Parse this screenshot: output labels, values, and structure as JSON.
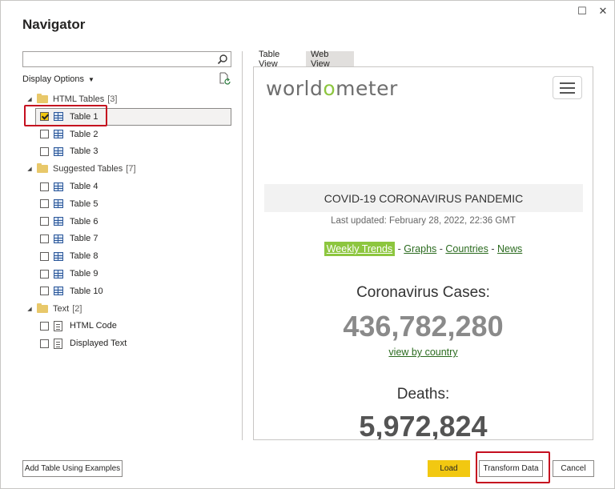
{
  "dialog": {
    "title": "Navigator",
    "minimize_glyph": "☐",
    "close_glyph": "✕"
  },
  "left_pane": {
    "search": {
      "value": "",
      "placeholder": ""
    },
    "display_options_label": "Display Options",
    "display_options_caret": "▼",
    "groups": [
      {
        "label": "HTML Tables",
        "count": "[3]",
        "expander": "◢",
        "items": [
          {
            "label": "Table 1",
            "checked": true,
            "icon": "table-icon"
          },
          {
            "label": "Table 2",
            "checked": false,
            "icon": "table-icon"
          },
          {
            "label": "Table 3",
            "checked": false,
            "icon": "table-icon"
          }
        ]
      },
      {
        "label": "Suggested Tables",
        "count": "[7]",
        "expander": "◢",
        "items": [
          {
            "label": "Table 4",
            "checked": false,
            "icon": "table-icon"
          },
          {
            "label": "Table 5",
            "checked": false,
            "icon": "table-icon"
          },
          {
            "label": "Table 6",
            "checked": false,
            "icon": "table-icon"
          },
          {
            "label": "Table 7",
            "checked": false,
            "icon": "table-icon"
          },
          {
            "label": "Table 8",
            "checked": false,
            "icon": "table-icon"
          },
          {
            "label": "Table 9",
            "checked": false,
            "icon": "table-icon"
          },
          {
            "label": "Table 10",
            "checked": false,
            "icon": "table-icon"
          }
        ]
      },
      {
        "label": "Text",
        "count": "[2]",
        "expander": "◢",
        "items": [
          {
            "label": "HTML Code",
            "checked": false,
            "icon": "document-icon"
          },
          {
            "label": "Displayed Text",
            "checked": false,
            "icon": "document-icon"
          }
        ]
      }
    ]
  },
  "right_pane": {
    "tabs": [
      {
        "label": "Table View",
        "active": false
      },
      {
        "label": "Web View",
        "active": true
      }
    ],
    "web_view": {
      "logo_prefix": "world",
      "logo_o": "o",
      "logo_suffix": "meter",
      "banner": "COVID-19 CORONAVIRUS PANDEMIC",
      "last_updated": "Last updated: February 28, 2022, 22:36 GMT",
      "links": [
        "Weekly Trends",
        "Graphs",
        "Countries",
        "News"
      ],
      "link_separator": " - ",
      "cases_label": "Coronavirus Cases:",
      "cases_value": "436,782,280",
      "cases_color": "#8a8a8a",
      "view_by_country": "view by country",
      "deaths_label": "Deaths:",
      "deaths_value": "5,972,824",
      "deaths_color": "#545454",
      "accent_color": "#8dc63f"
    }
  },
  "footer": {
    "add_table_label": "Add Table Using Examples",
    "load_label": "Load",
    "transform_label": "Transform Data",
    "cancel_label": "Cancel"
  },
  "colors": {
    "primary_button": "#f2c811",
    "highlight_border": "#c50f1f"
  }
}
